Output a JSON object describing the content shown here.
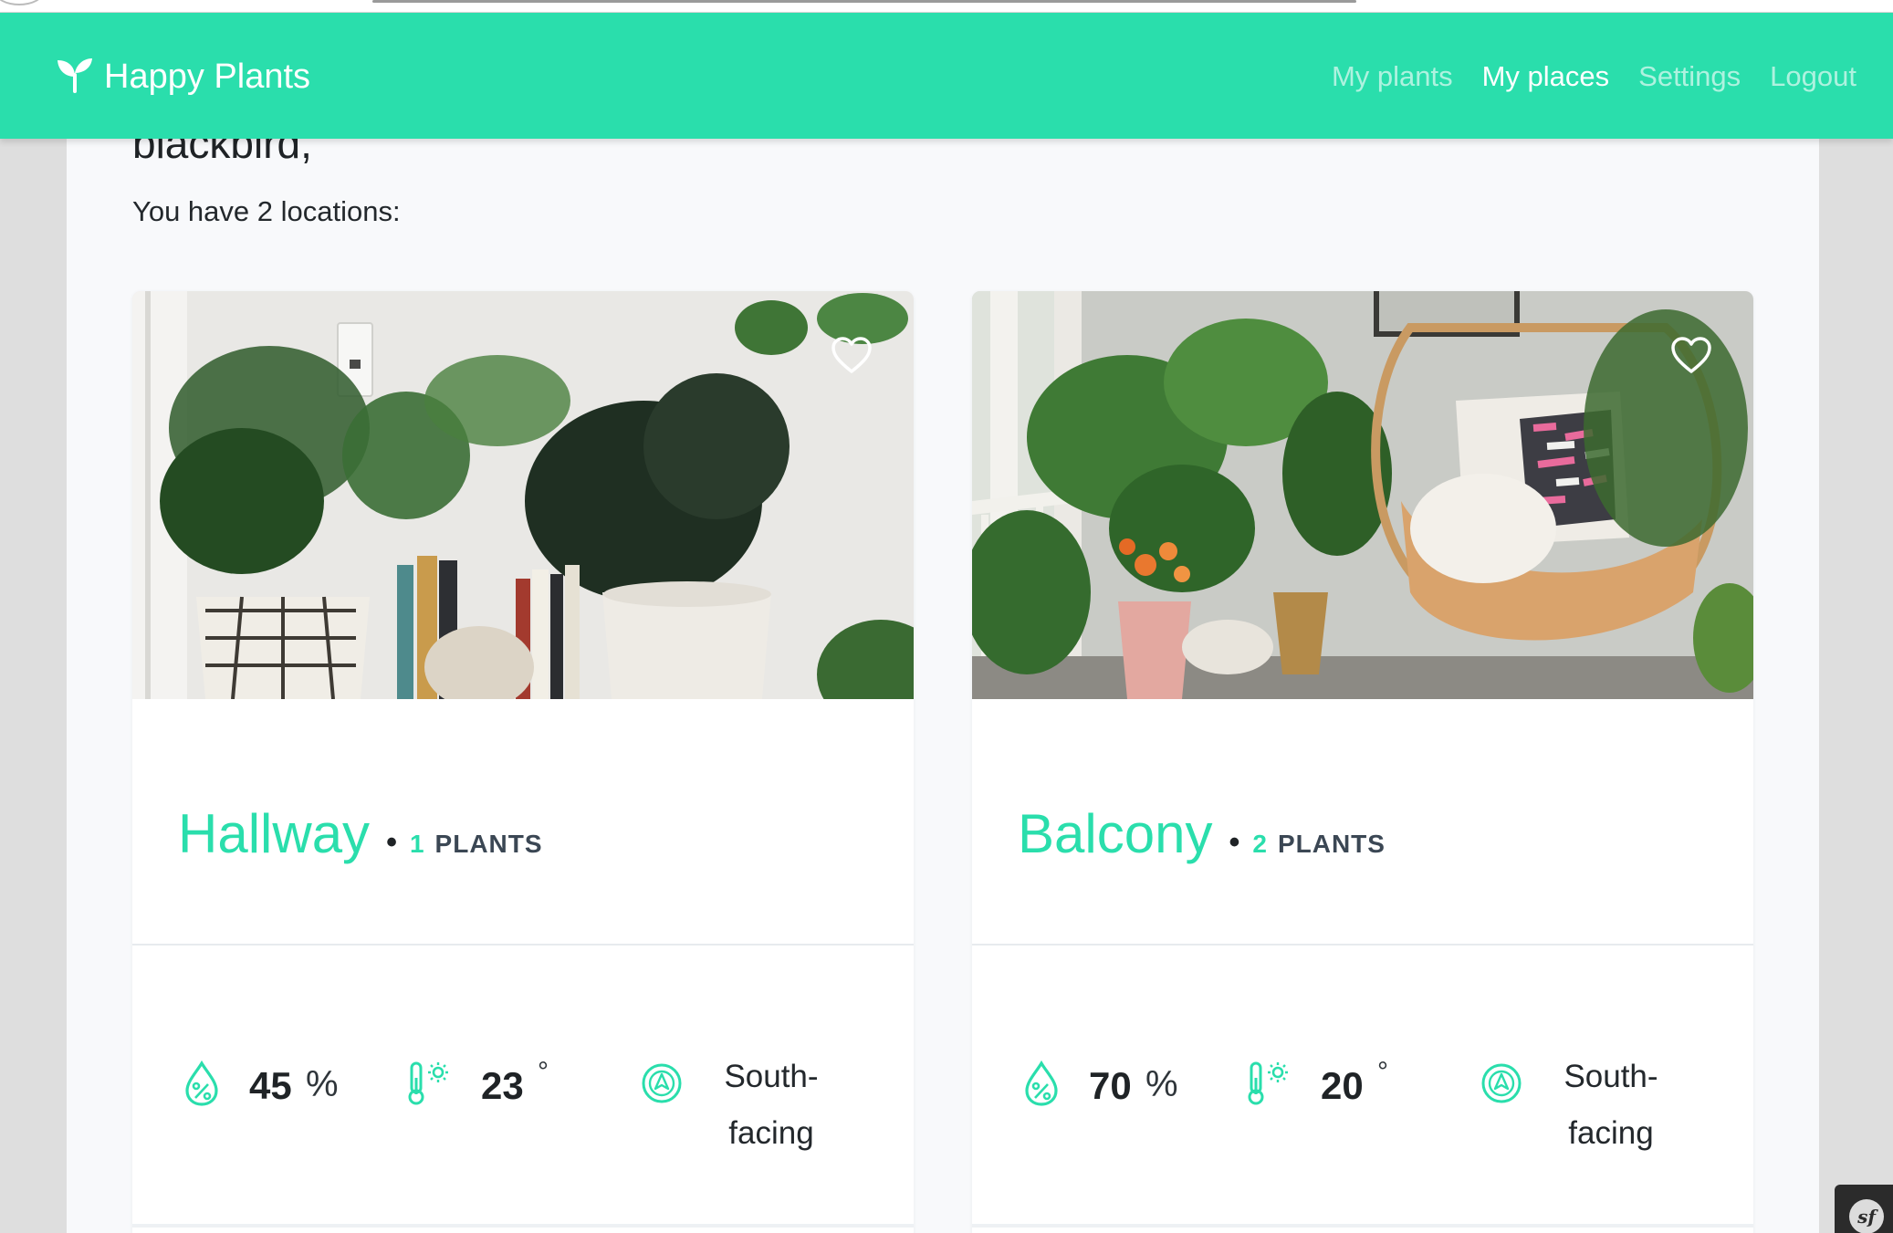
{
  "brand": {
    "name": "Happy Plants",
    "icon": "sprout-icon"
  },
  "nav": {
    "items": [
      {
        "label": "My plants",
        "active": false
      },
      {
        "label": "My places",
        "active": true
      },
      {
        "label": "Settings",
        "active": false
      },
      {
        "label": "Logout",
        "active": false
      }
    ]
  },
  "page": {
    "greeting": "blackbird,",
    "subtitle": "You have 2 locations:"
  },
  "locations": [
    {
      "name": "Hallway",
      "dot": "•",
      "plant_count": "1",
      "plants_label": "PLANTS",
      "humidity": {
        "value": "45",
        "unit": "%",
        "icon": "humidity-drop-icon"
      },
      "temperature": {
        "value": "23",
        "unit": "°",
        "icon": "thermometer-sun-icon"
      },
      "facing": "South-facing",
      "facing_icon": "compass-icon",
      "favorite_icon": "heart-outline-icon"
    },
    {
      "name": "Balcony",
      "dot": "•",
      "plant_count": "2",
      "plants_label": "PLANTS",
      "humidity": {
        "value": "70",
        "unit": "%",
        "icon": "humidity-drop-icon"
      },
      "temperature": {
        "value": "20",
        "unit": "°",
        "icon": "thermometer-sun-icon"
      },
      "facing": "South-facing",
      "facing_icon": "compass-icon",
      "favorite_icon": "heart-outline-icon"
    }
  ],
  "debug_toolbar": {
    "label": "sf"
  },
  "colors": {
    "accent": "#2adeac",
    "plants_label": "#3b4754",
    "page_background": "#f8f9fb",
    "outer_background": "#dedede"
  }
}
